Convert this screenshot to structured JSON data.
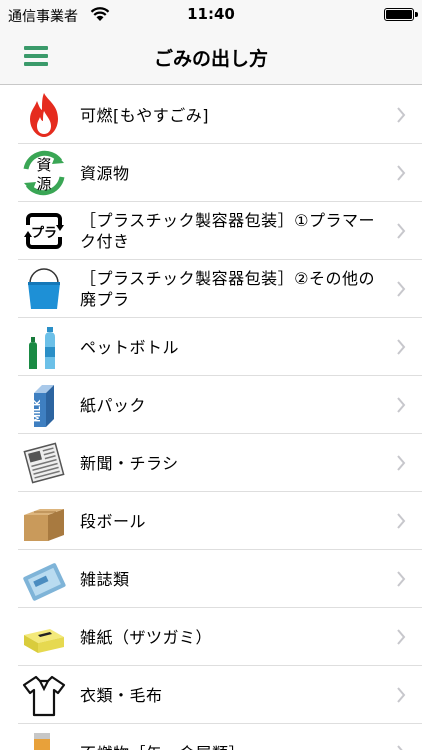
{
  "status_bar": {
    "carrier": "通信事業者",
    "time": "11:40"
  },
  "nav": {
    "title": "ごみの出し方",
    "menu_icon": "hamburger-menu-icon",
    "accent_color": "#3a9a6a"
  },
  "items": [
    {
      "label": "可燃[もやすごみ]",
      "icon": "fire-icon"
    },
    {
      "label": "資源物",
      "icon": "recycle-resource-icon",
      "icon_text": [
        "資",
        "源"
      ]
    },
    {
      "label": "［プラスチック製容器包装］①プラマーク付き",
      "icon": "plastic-mark-icon",
      "icon_text": "プラ"
    },
    {
      "label": "［プラスチック製容器包装］②その他の廃プラ",
      "icon": "bucket-icon"
    },
    {
      "label": "ペットボトル",
      "icon": "pet-bottles-icon"
    },
    {
      "label": "紙パック",
      "icon": "milk-carton-icon",
      "icon_text": "MILK"
    },
    {
      "label": "新聞・チラシ",
      "icon": "newspaper-icon"
    },
    {
      "label": "段ボール",
      "icon": "cardboard-box-icon"
    },
    {
      "label": "雑誌類",
      "icon": "magazine-icon"
    },
    {
      "label": "雑紙（ザツガミ）",
      "icon": "tissue-box-icon"
    },
    {
      "label": "衣類・毛布",
      "icon": "shirt-icon"
    },
    {
      "label": "不燃物［缶・金属類］",
      "icon": "can-icon"
    }
  ]
}
